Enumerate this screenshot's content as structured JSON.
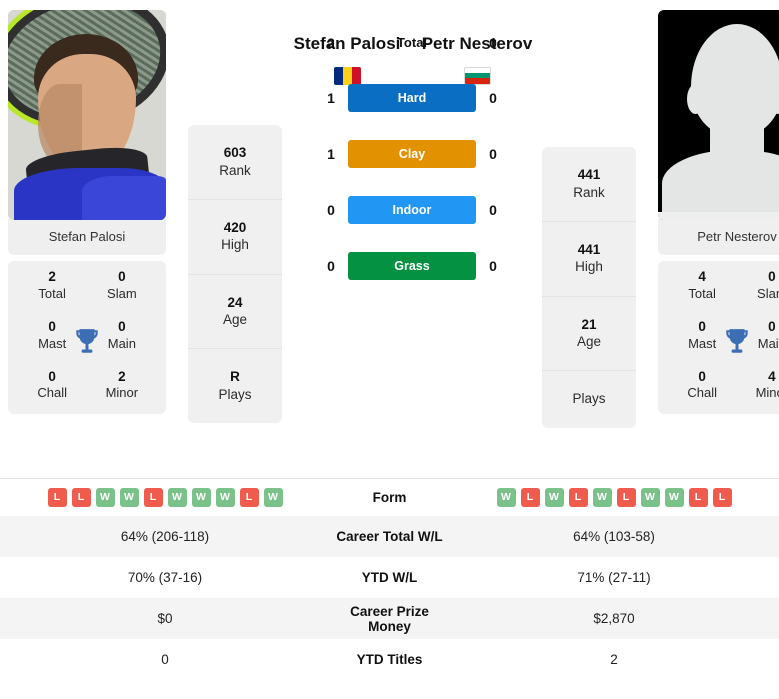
{
  "players": {
    "left": {
      "name": "Stefan Palosi",
      "photo_caption": "Stefan Palosi",
      "flag": {
        "name": "romania-flag",
        "type": "vertical",
        "colors": [
          "#002B7F",
          "#FCD116",
          "#CE1126"
        ]
      },
      "rank": {
        "value": "603",
        "label": "Rank"
      },
      "high": {
        "value": "420",
        "label": "High"
      },
      "age": {
        "value": "24",
        "label": "Age"
      },
      "plays": {
        "value": "R",
        "label": "Plays"
      },
      "titles": {
        "total": {
          "value": "2",
          "label": "Total"
        },
        "slam": {
          "value": "0",
          "label": "Slam"
        },
        "mast": {
          "value": "0",
          "label": "Mast"
        },
        "main": {
          "value": "0",
          "label": "Main"
        },
        "chall": {
          "value": "0",
          "label": "Chall"
        },
        "minor": {
          "value": "2",
          "label": "Minor"
        }
      },
      "form": [
        "L",
        "L",
        "W",
        "W",
        "L",
        "W",
        "W",
        "W",
        "L",
        "W"
      ],
      "career_total_wl": "64% (206-118)",
      "ytd_wl": "70% (37-16)",
      "career_prize_money": "$0",
      "ytd_titles": "0"
    },
    "right": {
      "name": "Petr Nesterov",
      "photo_caption": "Petr Nesterov",
      "flag": {
        "name": "bulgaria-flag",
        "type": "horizontal",
        "colors": [
          "#FFFFFF",
          "#00966E",
          "#D62612"
        ]
      },
      "rank": {
        "value": "441",
        "label": "Rank"
      },
      "high": {
        "value": "441",
        "label": "High"
      },
      "age": {
        "value": "21",
        "label": "Age"
      },
      "plays": {
        "value": "",
        "label": "Plays"
      },
      "titles": {
        "total": {
          "value": "4",
          "label": "Total"
        },
        "slam": {
          "value": "0",
          "label": "Slam"
        },
        "mast": {
          "value": "0",
          "label": "Mast"
        },
        "main": {
          "value": "0",
          "label": "Main"
        },
        "chall": {
          "value": "0",
          "label": "Chall"
        },
        "minor": {
          "value": "4",
          "label": "Minor"
        }
      },
      "form": [
        "W",
        "L",
        "W",
        "L",
        "W",
        "L",
        "W",
        "W",
        "L",
        "L"
      ],
      "career_total_wl": "64% (103-58)",
      "ytd_wl": "71% (27-11)",
      "career_prize_money": "$2,870",
      "ytd_titles": "2"
    }
  },
  "head_to_head": [
    {
      "label": "Total",
      "left": "2",
      "right": "0",
      "color": "",
      "text_color": "#111111",
      "badge": false
    },
    {
      "label": "Hard",
      "left": "1",
      "right": "0",
      "color": "#0a6fc2",
      "text_color": "#ffffff",
      "badge": true
    },
    {
      "label": "Clay",
      "left": "1",
      "right": "0",
      "color": "#e29100",
      "text_color": "#ffffff",
      "badge": true
    },
    {
      "label": "Indoor",
      "left": "0",
      "right": "0",
      "color": "#2196f3",
      "text_color": "#ffffff",
      "badge": true
    },
    {
      "label": "Grass",
      "left": "0",
      "right": "0",
      "color": "#059142",
      "text_color": "#ffffff",
      "badge": true
    }
  ],
  "table": {
    "rows": [
      {
        "label": "Form",
        "type": "form"
      },
      {
        "label": "Career Total W/L",
        "left": "64% (206-118)",
        "right": "64% (103-58)"
      },
      {
        "label": "YTD W/L",
        "left": "70% (37-16)",
        "right": "71% (27-11)"
      },
      {
        "label": "Career Prize Money",
        "left": "$0",
        "right": "$2,870"
      },
      {
        "label": "YTD Titles",
        "left": "0",
        "right": "2"
      }
    ]
  },
  "icons": {
    "trophy": "trophy-icon"
  },
  "colors": {
    "win_badge": "#7ac28a",
    "loss_badge": "#ef5b4c",
    "trophy": "#3c6eb4",
    "card_bg": "#f0f0f0",
    "row_alt": "#f4f4f4"
  }
}
